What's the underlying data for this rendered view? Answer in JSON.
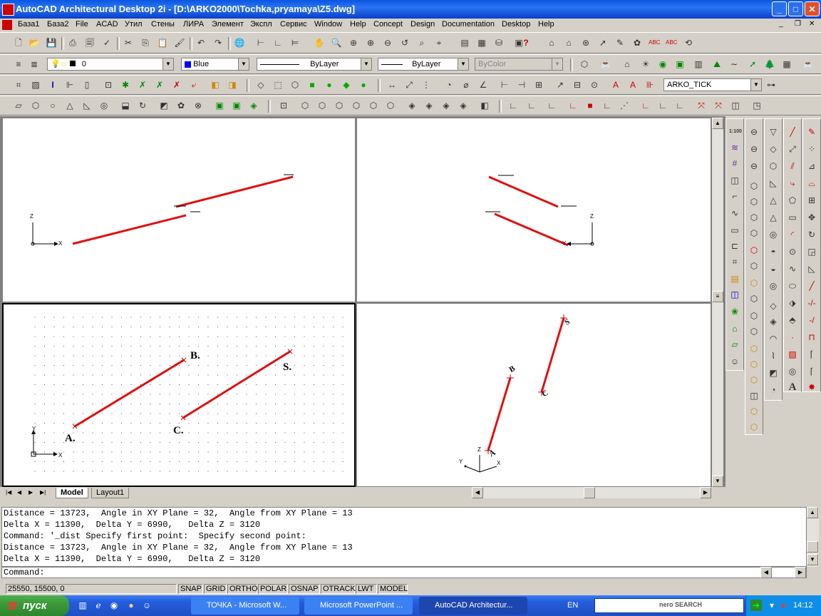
{
  "window": {
    "title": "AutoCAD Architectural Desktop 2i - [D:\\ARKO2000\\Tochka,pryamaya\\Z5.dwg]",
    "min": "_",
    "max": "□",
    "close": "✕"
  },
  "menu": [
    "База1",
    "База2",
    "File",
    "ACAD",
    "Утил",
    "Стены",
    "ЛИРА",
    "Элемент",
    "Экспл",
    "Сервис",
    "Window",
    "Help",
    "Concept",
    "Design",
    "Documentation",
    "Desktop",
    "Help"
  ],
  "layer_combo": {
    "value": "0"
  },
  "color_combo": {
    "value": "Blue",
    "swatch": "#0000ff"
  },
  "linetype_combo": {
    "value": "ByLayer"
  },
  "lineweight_combo": {
    "value": "ByLayer"
  },
  "plotstyle_combo": {
    "value": "ByColor"
  },
  "dimstyle_combo": {
    "value": "ARKO_TICK"
  },
  "viewports": {
    "top_left_axes": {
      "z": "Z",
      "x": "X"
    },
    "top_right_axes": {
      "z": "Z",
      "y": "Y"
    },
    "bottom_left": {
      "labels": [
        "A.",
        "B.",
        "C.",
        "S."
      ],
      "axes": {
        "y": "Y",
        "x": "X"
      }
    },
    "bottom_right": {
      "labels": [
        "A",
        "B",
        "C",
        "S"
      ],
      "axes": {
        "z": "Z",
        "y": "Y",
        "x": "X"
      }
    }
  },
  "tabs": [
    "Model",
    "Layout1"
  ],
  "command_lines": [
    "Distance = 13723,  Angle in XY Plane = 32,  Angle from XY Plane = 13",
    "Delta X = 11390,  Delta Y = 6990,   Delta Z = 3120",
    "Command: '_dist Specify first point:  Specify second point:",
    "Distance = 13723,  Angle in XY Plane = 32,  Angle from XY Plane = 13",
    "Delta X = 11390,  Delta Y = 6990,   Delta Z = 3120",
    "Command:"
  ],
  "status": {
    "coords": "25550, 15500, 0",
    "toggles": [
      "SNAP",
      "GRID",
      "ORTHO",
      "POLAR",
      "OSNAP",
      "OTRACK",
      "LWT",
      "MODEL"
    ]
  },
  "taskbar": {
    "start": "пуск",
    "tasks": [
      "ТОЧКА - Microsoft W...",
      "Microsoft PowerPoint ...",
      "AutoCAD Architectur..."
    ],
    "lang": "EN",
    "search": "nero SEARCH",
    "clock": "14:12"
  },
  "accent": {
    "line_red": "#e01010",
    "title_blue": "#0a56e0"
  }
}
